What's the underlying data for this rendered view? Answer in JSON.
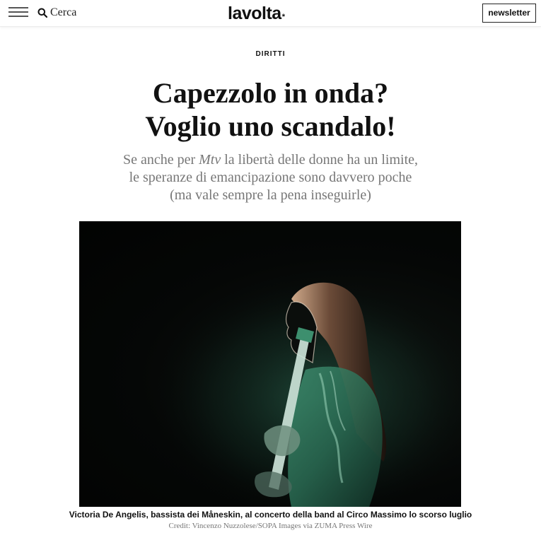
{
  "header": {
    "search_label": "Cerca",
    "logo_text": "lavolta",
    "logo_star": "*",
    "newsletter_label": "newsletter"
  },
  "article": {
    "section": "DIRITTI",
    "headline_line1": "Capezzolo in onda?",
    "headline_line2": "Voglio uno scandalo!",
    "sub_line1_before": "Se anche per ",
    "sub_line1_em": "Mtv",
    "sub_line1_after": " la libertà delle donne ha un limite,",
    "sub_line2": "le speranze di emancipazione sono davvero poche",
    "sub_line3": "(ma vale sempre la pena inseguirle)",
    "caption": "Victoria De Angelis, bassista dei Måneskin, al concerto della band al Circo Massimo lo scorso luglio",
    "credit": "Credit: Vincenzo Nuzzolese/SOPA Images via ZUMA Press Wire"
  },
  "icons": {
    "menu": "hamburger-menu-icon",
    "search": "search-icon"
  },
  "colors": {
    "text": "#111111",
    "muted": "#777777",
    "hero_glow": "#2b6e55"
  }
}
